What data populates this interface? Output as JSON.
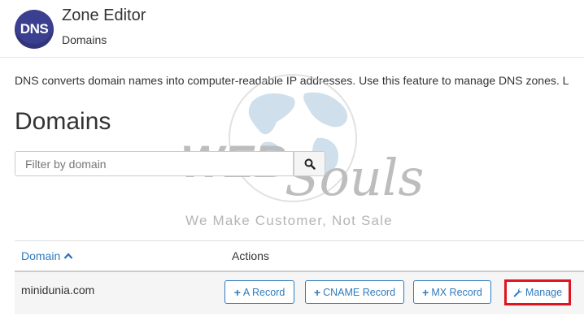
{
  "header": {
    "icon_text": "DNS",
    "title": "Zone Editor",
    "breadcrumb": "Domains"
  },
  "description": "DNS converts domain names into computer-readable IP addresses. Use this feature to manage DNS zones. L",
  "section_heading": "Domains",
  "filter": {
    "placeholder": "Filter by domain",
    "button_icon": "search-icon"
  },
  "watermark": {
    "brand": "WEB Souls",
    "tagline": "We Make Customer, Not Sale"
  },
  "table": {
    "columns": {
      "domain": "Domain",
      "actions": "Actions"
    },
    "sort_icon": "chevron-up-icon",
    "rows": [
      {
        "domain": "minidunia.com",
        "actions": {
          "a_record": "A Record",
          "cname_record": "CNAME Record",
          "mx_record": "MX Record",
          "manage": "Manage"
        }
      }
    ]
  },
  "colors": {
    "link": "#2f7bbf",
    "highlight": "#e0141e",
    "icon_bg": "#3b3f8f"
  }
}
